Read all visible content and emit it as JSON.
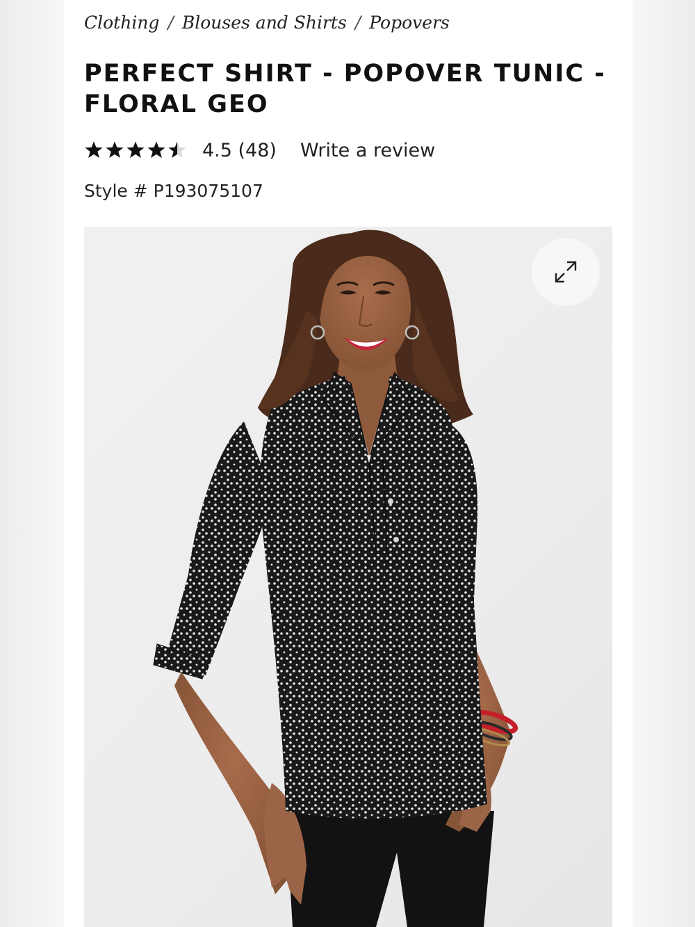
{
  "breadcrumb": {
    "items": [
      "Clothing",
      "Blouses and Shirts",
      "Popovers"
    ],
    "separator": "/"
  },
  "product": {
    "title": "Perfect Shirt - Popover Tunic - Floral Geo",
    "rating_value": 4.5,
    "rating_max": 5,
    "rating_text": "4.5 (48)",
    "write_review_label": "Write a review",
    "style_number": "Style # P193075107"
  },
  "image": {
    "alt": "Perfect Shirt - Popover Tunic - Floral Geo",
    "expand_icon": "expand-arrows-icon"
  },
  "colors": {
    "star": "#111111",
    "star_empty": "#d9d9d9",
    "shirt": "#1a1a1a",
    "shirt_dots": "#e8e8e8",
    "pants": "#121212",
    "skin": "#9c6446",
    "hair": "#4a2a1a",
    "lips": "#c4243a",
    "bracelet_red": "#c4202a"
  }
}
